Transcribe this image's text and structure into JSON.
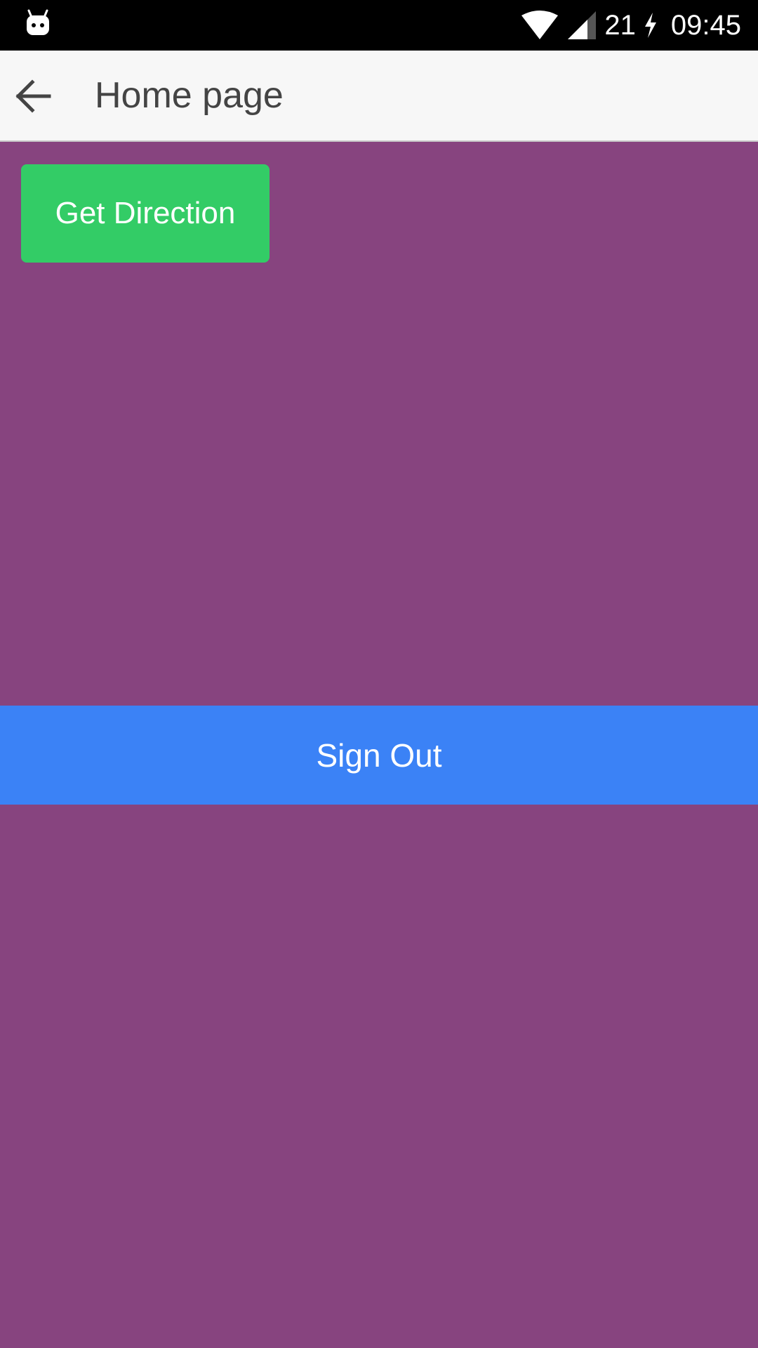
{
  "status_bar": {
    "notification_icon": "android-robot-icon",
    "wifi_icon": "wifi-icon",
    "signal_icon": "cell-signal-icon",
    "battery_level": "21",
    "charging_icon": "charging-bolt-icon",
    "time": "09:45"
  },
  "app_bar": {
    "back_icon": "arrow-back-icon",
    "title": "Home page"
  },
  "main": {
    "get_direction_label": "Get Direction",
    "sign_out_label": "Sign Out"
  },
  "colors": {
    "background": "#87447f",
    "status_bar": "#000000",
    "app_bar": "#f7f7f7",
    "get_direction_button": "#33cc66",
    "sign_out_button": "#3b82f6",
    "title_text": "#444444"
  }
}
